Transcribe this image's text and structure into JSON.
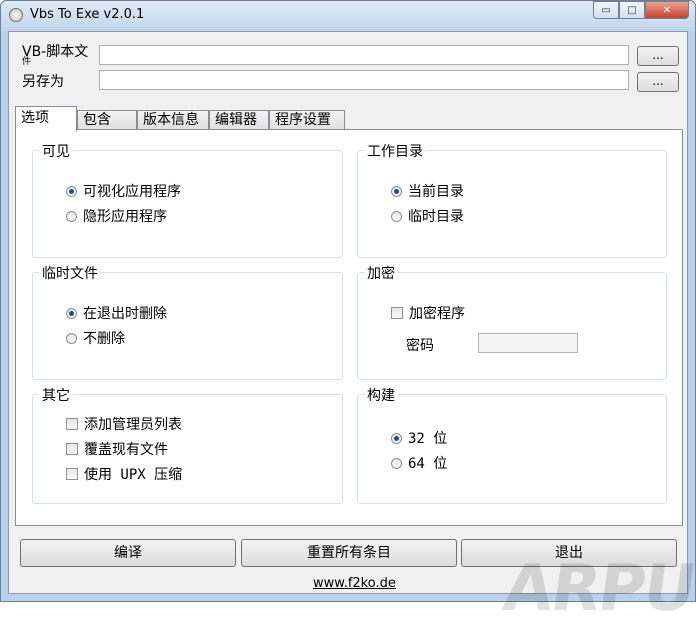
{
  "window": {
    "title": "Vbs To Exe v2.0.1",
    "controls": {
      "minimize": "▭",
      "maximize": "□",
      "close": "✕"
    }
  },
  "files": {
    "vbs_label": "VB-脚本文\n件",
    "vbs_label_main": "VB-脚本文",
    "vbs_label_sub": "件",
    "vbs_value": "",
    "saveas_label": "另存为",
    "saveas_value": "",
    "browse_label": "..."
  },
  "tabs": [
    "选项",
    "包含",
    "版本信息",
    "编辑器",
    "程序设置"
  ],
  "options": {
    "visible": {
      "title": "可见",
      "items": [
        {
          "label": "可视化应用程序",
          "checked": true
        },
        {
          "label": "隐形应用程序",
          "checked": false
        }
      ]
    },
    "workdir": {
      "title": "工作目录",
      "items": [
        {
          "label": "当前目录",
          "checked": true
        },
        {
          "label": "临时目录",
          "checked": false
        }
      ]
    },
    "tempfiles": {
      "title": "临时文件",
      "items": [
        {
          "label": "在退出时删除",
          "checked": true
        },
        {
          "label": "不删除",
          "checked": false
        }
      ]
    },
    "encrypt": {
      "title": "加密",
      "checkbox_label": "加密程序",
      "password_label": "密码",
      "password_value": ""
    },
    "other": {
      "title": "其它",
      "items": [
        {
          "label": "添加管理员列表",
          "checked": false
        },
        {
          "label": "覆盖现有文件",
          "checked": false
        },
        {
          "label": "使用 UPX 压缩",
          "checked": false
        }
      ]
    },
    "build": {
      "title": "构建",
      "items": [
        {
          "label": "32 位",
          "checked": true
        },
        {
          "label": "64 位",
          "checked": false
        }
      ]
    }
  },
  "buttons": {
    "compile": "编译",
    "reset": "重置所有条目",
    "exit": "退出"
  },
  "footer_link": "www.f2ko.de",
  "watermark": "ARPUN"
}
